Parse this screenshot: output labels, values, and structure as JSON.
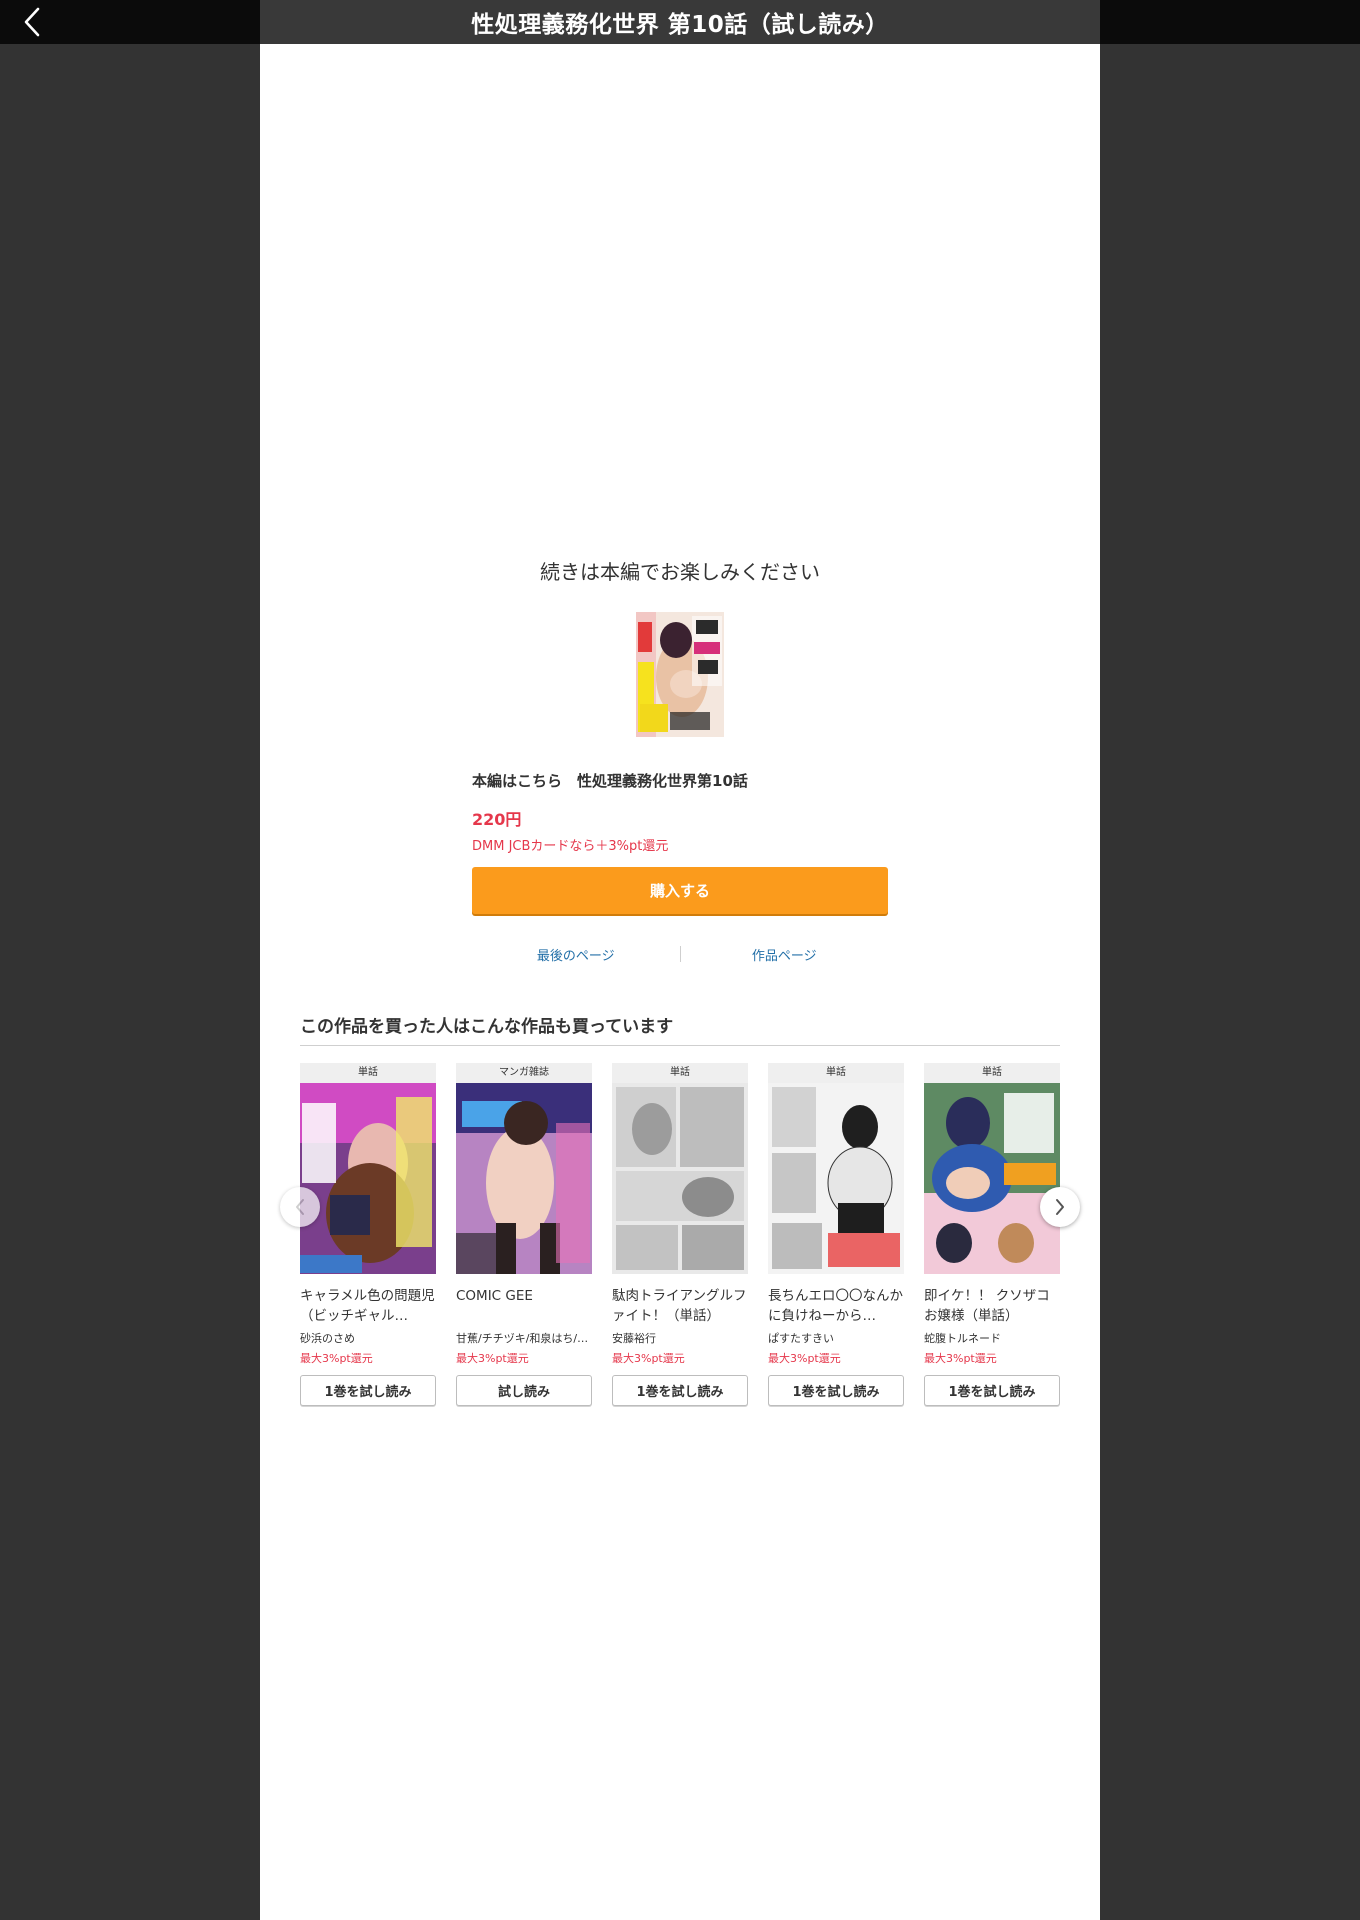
{
  "viewer": {
    "title": "性処理義務化世界 第10話（試し読み）",
    "back_icon": "chevron-left-icon"
  },
  "end_panel": {
    "message": "続きは本編でお楽しみください",
    "product_title": "本編はこちら　性処理義務化世界第10話",
    "price": "220円",
    "campaign": "DMM JCBカードなら＋3%pt還元",
    "buy_label": "購入する",
    "last_page_label": "最後のページ",
    "work_page_label": "作品ページ"
  },
  "recommend": {
    "heading": "この作品を買った人はこんな作品も買っています",
    "items": [
      {
        "category": "単話",
        "title": "キャラメル色の問題児（ビッチギャル…",
        "author": "砂浜のさめ",
        "points": "最大3%pt還元",
        "button": "1巻を試し読み"
      },
      {
        "category": "マンガ雑誌",
        "title": "COMIC GEE",
        "author": "甘蕉/チチヅキ/和泉はち/…",
        "points": "最大3%pt還元",
        "button": "試し読み"
      },
      {
        "category": "単話",
        "title": "駄肉トライアングルファイト！（単話）",
        "author": "安藤裕行",
        "points": "最大3%pt還元",
        "button": "1巻を試し読み"
      },
      {
        "category": "単話",
        "title": "長ちんエロ〇〇なんかに負けねーから…",
        "author": "ぱすたすきい",
        "points": "最大3%pt還元",
        "button": "1巻を試し読み"
      },
      {
        "category": "単話",
        "title": "即イケ！！ クソザコお嬢様（単話）",
        "author": "蛇腹トルネード",
        "points": "最大3%pt還元",
        "button": "1巻を試し読み"
      }
    ]
  },
  "colors": {
    "accent_orange": "#fb9b1c",
    "price_red": "#e5374b",
    "link_blue": "#2470a8"
  }
}
